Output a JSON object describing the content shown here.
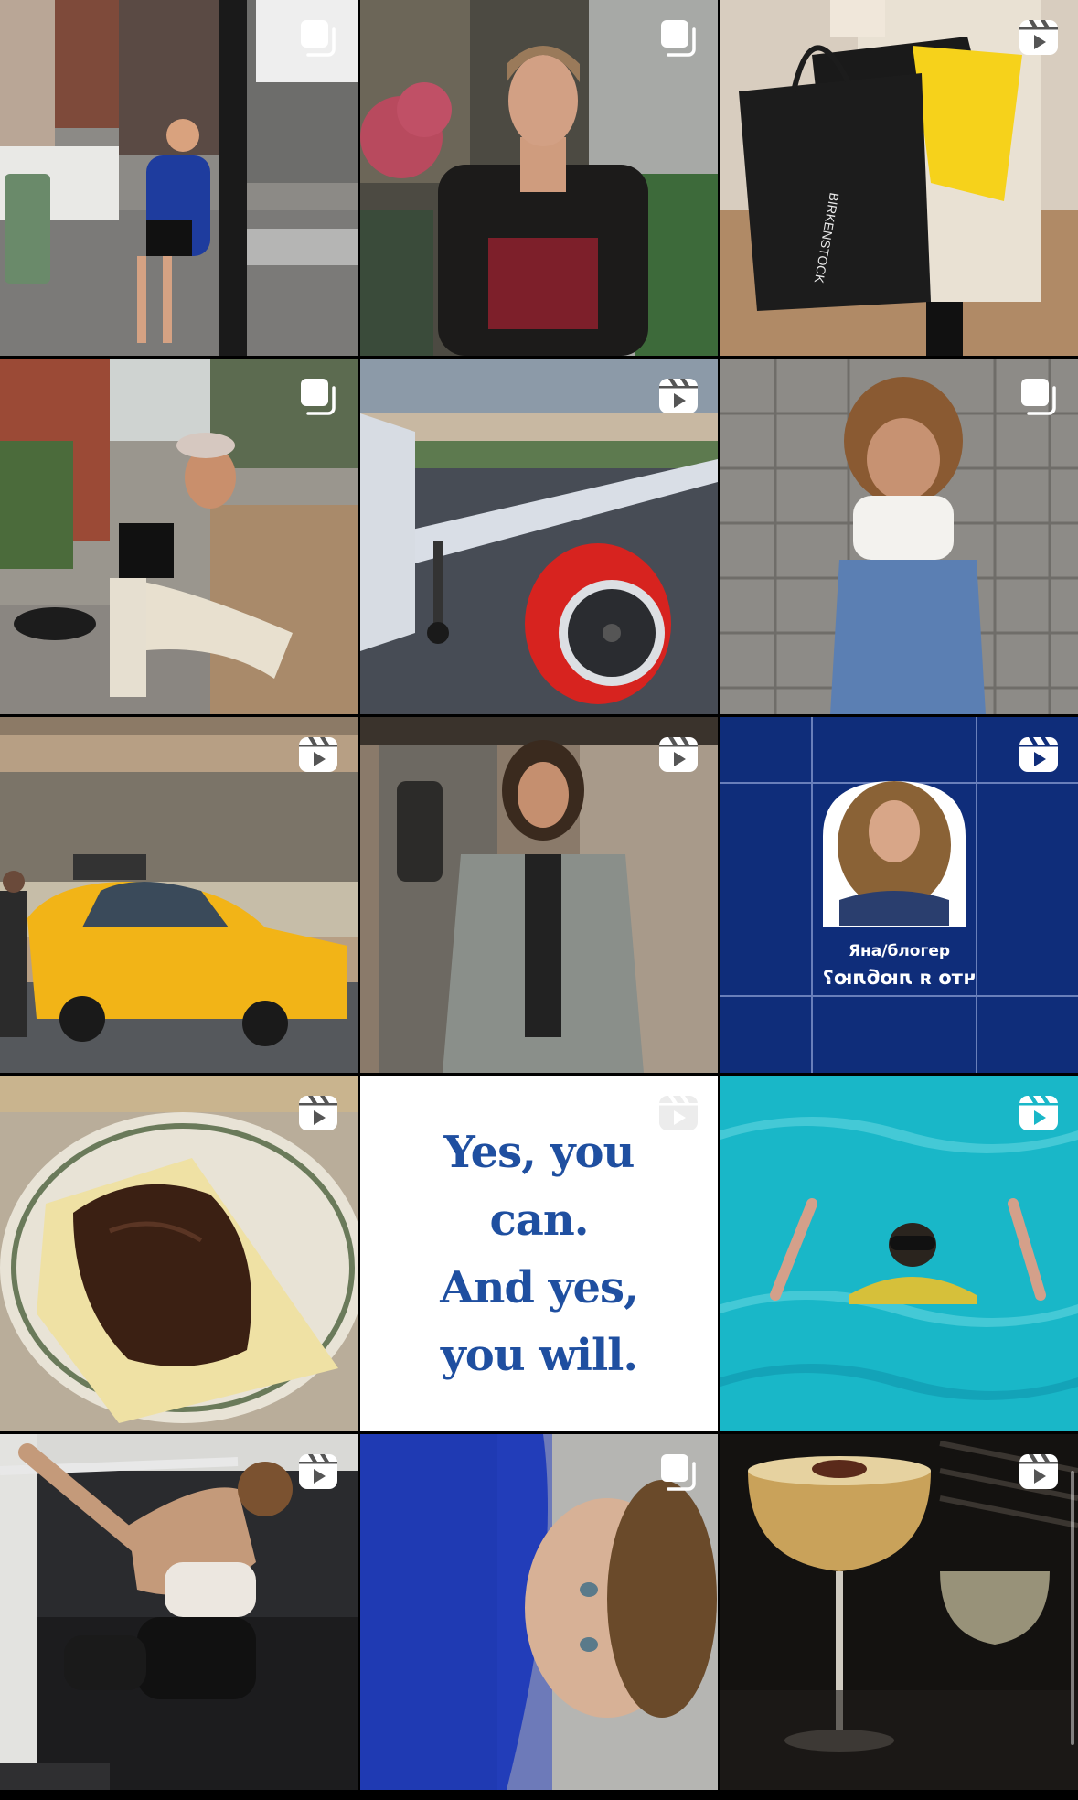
{
  "grid": {
    "posts": [
      {
        "id": "street-blue-shirt",
        "badge": "carousel"
      },
      {
        "id": "leather-jacket-portrait",
        "badge": "carousel"
      },
      {
        "id": "shopping-bags",
        "badge": "reel",
        "bag_text": "BIRKENSTOCK"
      },
      {
        "id": "bench-sunglasses",
        "badge": "carousel"
      },
      {
        "id": "airplane-engine",
        "badge": "reel"
      },
      {
        "id": "steps-sitting",
        "badge": "carousel"
      },
      {
        "id": "yellow-taxi",
        "badge": "reel"
      },
      {
        "id": "subway-portrait",
        "badge": "reel"
      },
      {
        "id": "sticker-blue",
        "badge": "reel",
        "caption_line1": "Яна/блогер",
        "caption_line2": "что я люблю?"
      },
      {
        "id": "chocolate-toast",
        "badge": "reel"
      },
      {
        "id": "text-quote",
        "badge": "reel",
        "quote_lines": [
          "Yes, you",
          "can.",
          "And yes,",
          "you will."
        ]
      },
      {
        "id": "sea-swim",
        "badge": "reel"
      },
      {
        "id": "gym-workout",
        "badge": "reel"
      },
      {
        "id": "blue-selfie",
        "badge": "carousel"
      },
      {
        "id": "cocktails",
        "badge": "reel"
      }
    ]
  },
  "colors": {
    "quote_text": "#1f4fa0",
    "sticker_bg": "#0f2d7a",
    "taxi": "#f2b417",
    "sea": "#19b7c8"
  }
}
